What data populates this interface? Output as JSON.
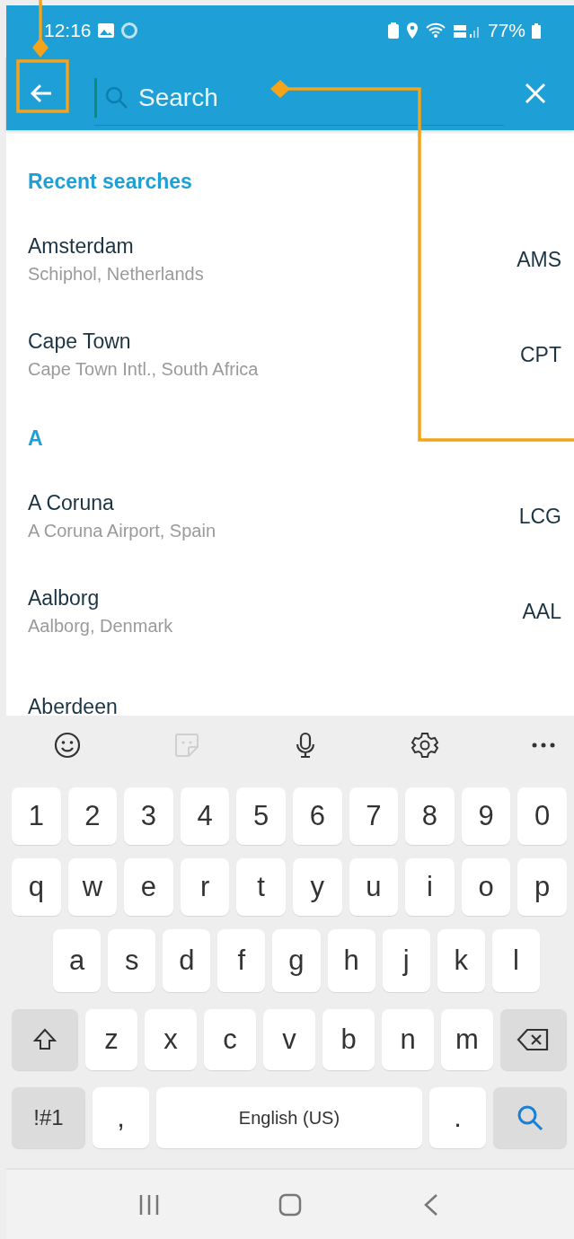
{
  "status_bar": {
    "time": "12:16",
    "battery": "77%"
  },
  "search": {
    "placeholder": "Search"
  },
  "sections": [
    {
      "heading": "Recent searches",
      "items": [
        {
          "city": "Amsterdam",
          "airport": "Schiphol, Netherlands",
          "code": "AMS"
        },
        {
          "city": "Cape Town",
          "airport": "Cape Town Intl., South Africa",
          "code": "CPT"
        }
      ]
    },
    {
      "heading": "A",
      "items": [
        {
          "city": "A Coruna",
          "airport": "A Coruna Airport, Spain",
          "code": "LCG"
        },
        {
          "city": "Aalborg",
          "airport": "Aalborg, Denmark",
          "code": "AAL"
        },
        {
          "city": "Aberdeen"
        }
      ]
    }
  ],
  "keyboard": {
    "toolbar": [
      {
        "kind": "emoji",
        "disabled": false
      },
      {
        "kind": "sticker",
        "disabled": true
      },
      {
        "kind": "mic",
        "disabled": false
      },
      {
        "kind": "settings",
        "disabled": false
      },
      {
        "kind": "more",
        "disabled": false
      }
    ],
    "key_rows": [
      {
        "keys": [
          {
            "kind": "char",
            "label": "1"
          },
          {
            "kind": "char",
            "label": "2"
          },
          {
            "kind": "char",
            "label": "3"
          },
          {
            "kind": "char",
            "label": "4"
          },
          {
            "kind": "char",
            "label": "5"
          },
          {
            "kind": "char",
            "label": "6"
          },
          {
            "kind": "char",
            "label": "7"
          },
          {
            "kind": "char",
            "label": "8"
          },
          {
            "kind": "char",
            "label": "9"
          },
          {
            "kind": "char",
            "label": "0"
          }
        ]
      },
      {
        "keys": [
          {
            "kind": "char",
            "label": "q"
          },
          {
            "kind": "char",
            "label": "w"
          },
          {
            "kind": "char",
            "label": "e"
          },
          {
            "kind": "char",
            "label": "r"
          },
          {
            "kind": "char",
            "label": "t"
          },
          {
            "kind": "char",
            "label": "y"
          },
          {
            "kind": "char",
            "label": "u"
          },
          {
            "kind": "char",
            "label": "i"
          },
          {
            "kind": "char",
            "label": "o"
          },
          {
            "kind": "char",
            "label": "p"
          }
        ]
      },
      {
        "keys": [
          {
            "kind": "char",
            "label": "a"
          },
          {
            "kind": "char",
            "label": "s"
          },
          {
            "kind": "char",
            "label": "d"
          },
          {
            "kind": "char",
            "label": "f"
          },
          {
            "kind": "char",
            "label": "g"
          },
          {
            "kind": "char",
            "label": "h"
          },
          {
            "kind": "char",
            "label": "j"
          },
          {
            "kind": "char",
            "label": "k"
          },
          {
            "kind": "char",
            "label": "l"
          }
        ]
      },
      {
        "keys": [
          {
            "kind": "shift"
          },
          {
            "kind": "char",
            "label": "z"
          },
          {
            "kind": "char",
            "label": "x"
          },
          {
            "kind": "char",
            "label": "c"
          },
          {
            "kind": "char",
            "label": "v"
          },
          {
            "kind": "char",
            "label": "b"
          },
          {
            "kind": "char",
            "label": "n"
          },
          {
            "kind": "char",
            "label": "m"
          },
          {
            "kind": "backspace"
          }
        ]
      },
      {
        "keys": [
          {
            "kind": "symbols",
            "label": "!#1"
          },
          {
            "kind": "char",
            "label": ","
          },
          {
            "kind": "space",
            "label": "English (US)"
          },
          {
            "kind": "char",
            "label": "."
          },
          {
            "kind": "search"
          }
        ]
      }
    ]
  }
}
